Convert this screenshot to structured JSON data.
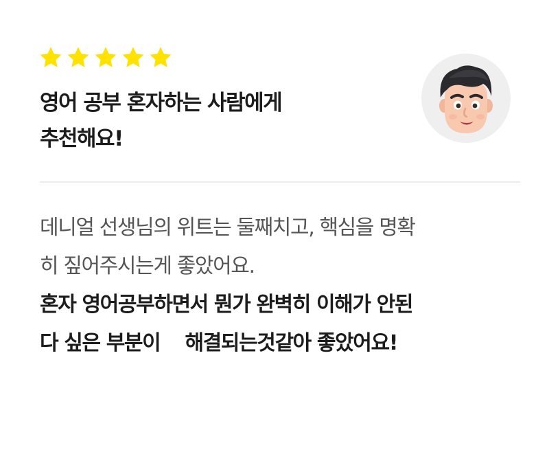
{
  "review": {
    "rating": 5,
    "rating_max": 5,
    "star_color": "#FFE200",
    "star_icon": "star-icon",
    "title_lines": [
      "영어 공부 혼자하는 사람에게",
      "추천해요!"
    ],
    "avatar_icon": "user-avatar-3d-face",
    "avatar_bg": "#EFEFEF",
    "body_regular_lines": [
      "데니얼 선생님의 위트는 둘째치고, 핵심을 명확",
      "히 짚어주시는게 좋았어요."
    ],
    "body_bold_lines": [
      "혼자 영어공부하면서 뭔가 완벽히 이해가 안된",
      "다 싶은 부분이    해결되는것같아 좋았어요!"
    ]
  }
}
